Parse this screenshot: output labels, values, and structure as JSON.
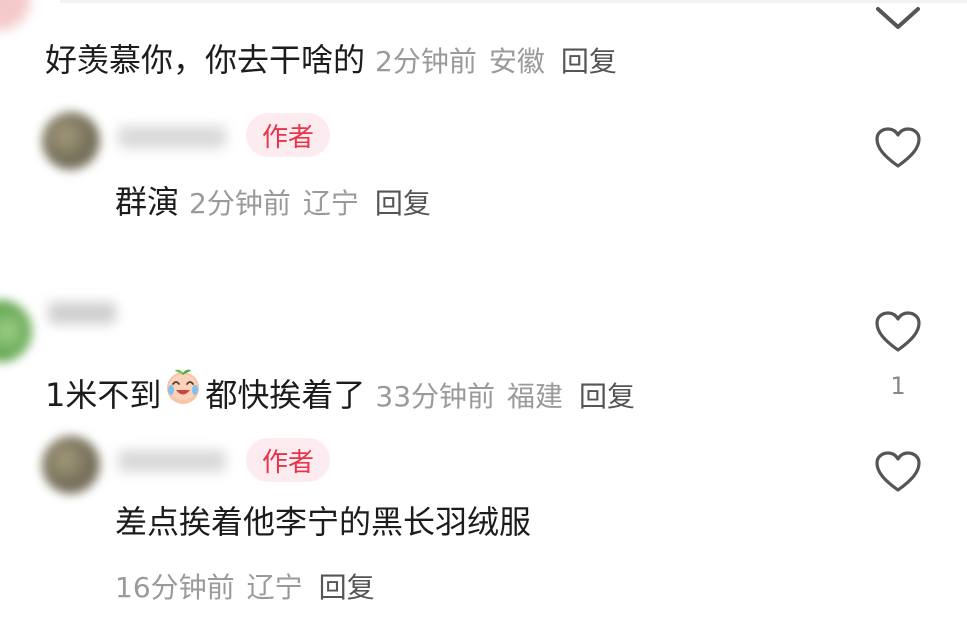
{
  "comments": [
    {
      "text": "好羡慕你，你去干啥的",
      "time": "2分钟前",
      "location": "安徽",
      "reply": "回复"
    },
    {
      "badge": "作者",
      "text": "群演",
      "time": "2分钟前",
      "location": "辽宁",
      "reply": "回复"
    },
    {
      "text_before": "1米不到",
      "emoji": "laughing-crying-peach-emoji",
      "text_after": "都快挨着了",
      "time": "33分钟前",
      "location": "福建",
      "reply": "回复",
      "likes": "1"
    },
    {
      "badge": "作者",
      "text": "差点挨着他李宁的黑长羽绒服",
      "time": "16分钟前",
      "location": "辽宁",
      "reply": "回复"
    }
  ],
  "colors": {
    "badge_text": "#e8334a",
    "badge_bg": "#fdecef",
    "meta": "#9a9a9a"
  },
  "icons": {
    "like": "heart-outline-icon",
    "collapse": "chevron-down-icon"
  }
}
